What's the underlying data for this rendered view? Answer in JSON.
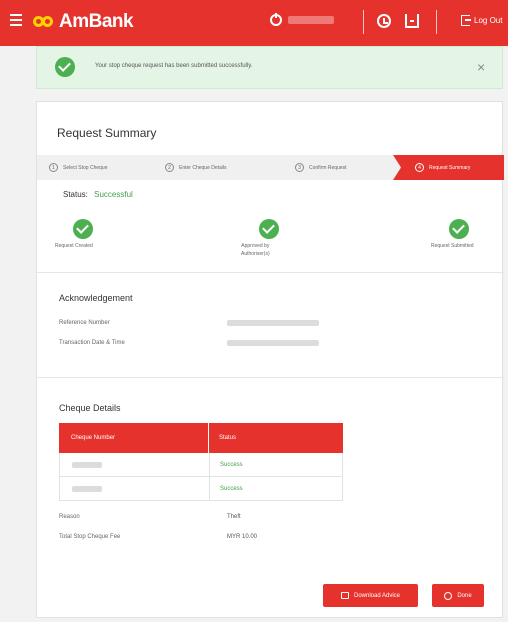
{
  "header": {
    "brand": "AmBank",
    "username": "",
    "logout_label": "Log Out"
  },
  "alert": {
    "message": "Your stop cheque request has been submitted successfully."
  },
  "page": {
    "title": "Request Summary"
  },
  "steps": [
    {
      "num": "1",
      "label": "Select Stop Cheque"
    },
    {
      "num": "2",
      "label": "Enter Cheque Details"
    },
    {
      "num": "3",
      "label": "Confirm Request"
    },
    {
      "num": "4",
      "label": "Request Summary"
    }
  ],
  "status": {
    "label": "Status:",
    "value": "Successful"
  },
  "milestones": [
    {
      "line1": "Request Created",
      "line2": ""
    },
    {
      "line1": "Approved by",
      "line2": "Authoriser(s)"
    },
    {
      "line1": "Request Submitted",
      "line2": ""
    }
  ],
  "acknowledgement": {
    "title": "Acknowledgement",
    "reference_label": "Reference Number",
    "reference_value": "",
    "datetime_label": "Transaction Date & Time",
    "datetime_value": ""
  },
  "cheque_details": {
    "title": "Cheque Details",
    "columns": [
      "Cheque Number",
      "Status"
    ],
    "rows": [
      {
        "number": "",
        "status": "Success"
      },
      {
        "number": "",
        "status": "Success"
      }
    ],
    "reason_label": "Reason",
    "reason_value": "Theft",
    "fee_label": "Total Stop Cheque Fee",
    "fee_value": "MYR 10.00"
  },
  "actions": {
    "download_label": "Download Advice",
    "done_label": "Done"
  },
  "colors": {
    "brand_red": "#e5322d",
    "success_green": "#4caf50"
  }
}
